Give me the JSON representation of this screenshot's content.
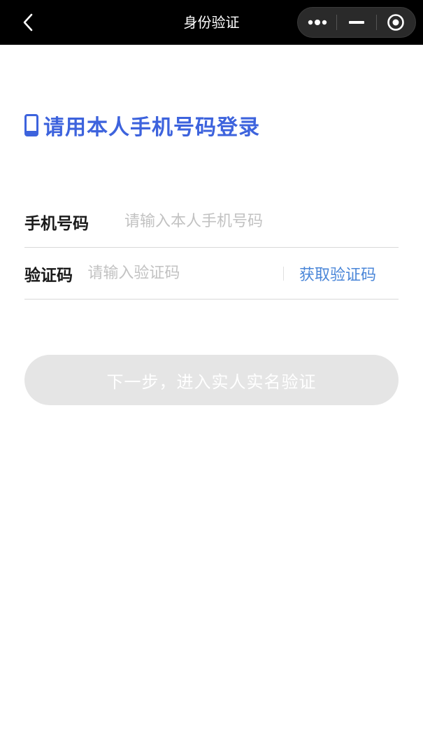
{
  "navbar": {
    "title": "身份验证",
    "back_icon": "chevron-left-icon",
    "more_icon": "more-dots-icon",
    "minimize_icon": "minimize-icon",
    "close_icon": "target-circle-icon"
  },
  "login": {
    "title": "请用本人手机号码登录",
    "title_icon": "phone-icon",
    "accent_color": "#3d63dd"
  },
  "form": {
    "phone_label": "手机号码",
    "phone_placeholder": "请输入本人手机号码",
    "phone_value": "",
    "code_label": "验证码",
    "code_placeholder": "请输入验证码",
    "code_value": "",
    "get_code_label": "获取验证码",
    "link_color": "#4a86d8"
  },
  "next_button": {
    "label": "下一步，进入实人实名验证",
    "disabled_bg": "#e5e5e5"
  }
}
